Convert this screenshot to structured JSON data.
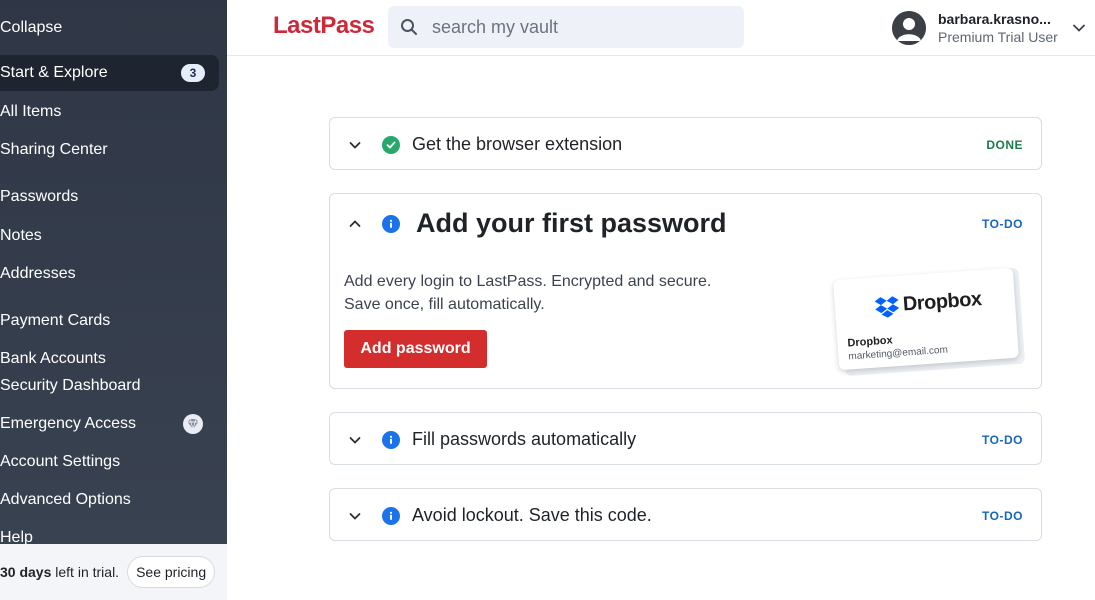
{
  "sidebar": {
    "collapse_label": "Collapse",
    "items": [
      {
        "label": "Start & Explore",
        "badge": "3"
      },
      {
        "label": "All Items"
      },
      {
        "label": "Sharing Center"
      },
      {
        "label": "Passwords"
      },
      {
        "label": "Notes"
      },
      {
        "label": "Addresses"
      },
      {
        "label": "Payment Cards"
      },
      {
        "label": "Bank Accounts"
      },
      {
        "label": "Security Dashboard"
      },
      {
        "label": "Emergency Access",
        "icon": "gem-icon"
      },
      {
        "label": "Account Settings"
      },
      {
        "label": "Advanced Options"
      },
      {
        "label": "Help"
      }
    ],
    "trial": {
      "days": "30 days",
      "suffix": "left in trial.",
      "cta": "See pricing"
    }
  },
  "header": {
    "logo": "LastPass",
    "search_placeholder": "search my vault",
    "user_name": "barbara.krasno...",
    "user_plan": "Premium Trial User"
  },
  "cards": [
    {
      "title": "Get the browser extension",
      "status": "DONE",
      "status_icon": "check-circle-icon",
      "expanded": false
    },
    {
      "title": "Add your first password",
      "status": "TO-DO",
      "status_icon": "info-icon",
      "expanded": true,
      "desc_line1": "Add every login to LastPass. Encrypted and secure.",
      "desc_line2": "Save once, fill automatically.",
      "button": "Add password",
      "illustration": {
        "brand": "Dropbox",
        "item_name": "Dropbox",
        "item_email": "marketing@email.com"
      }
    },
    {
      "title": "Fill passwords automatically",
      "status": "TO-DO",
      "status_icon": "info-icon",
      "expanded": false
    },
    {
      "title": "Avoid lockout. Save this code.",
      "status": "TO-DO",
      "status_icon": "info-icon",
      "expanded": false
    }
  ],
  "colors": {
    "sidebar_bg": "#343c4b",
    "brand_red": "#cc2a3a",
    "button_red": "#d32d2d",
    "done_green": "#1c7a4a",
    "todo_blue": "#1766c2",
    "check_green": "#28a96b",
    "info_blue": "#1a73e8"
  }
}
